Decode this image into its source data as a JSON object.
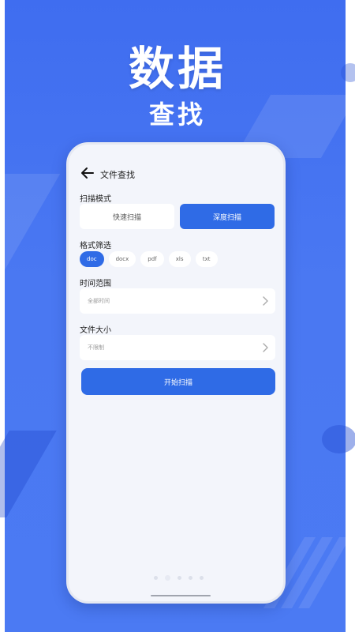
{
  "headline": {
    "line1": "数据",
    "line2": "查找"
  },
  "nav": {
    "title": "文件查找"
  },
  "scan_mode": {
    "label": "扫描模式",
    "options": [
      "快速扫描",
      "深度扫描"
    ],
    "selected": "深度扫描"
  },
  "format_filter": {
    "label": "格式筛选",
    "chips": [
      "doc",
      "docx",
      "pdf",
      "xls",
      "txt"
    ],
    "selected": "doc"
  },
  "time_range": {
    "label": "时间范围",
    "value": "全部时间"
  },
  "file_size": {
    "label": "文件大小",
    "value": "不限制"
  },
  "start_button": {
    "label": "开始扫描"
  },
  "carousel": {
    "count": 5,
    "active_index": 1
  },
  "colors": {
    "background": "#4a78f2",
    "accent": "#2f6be6",
    "surface": "#f3f5fb",
    "card": "#ffffff"
  },
  "icons": {
    "back": "arrow-left-icon",
    "chevron": "chevron-right-icon"
  }
}
